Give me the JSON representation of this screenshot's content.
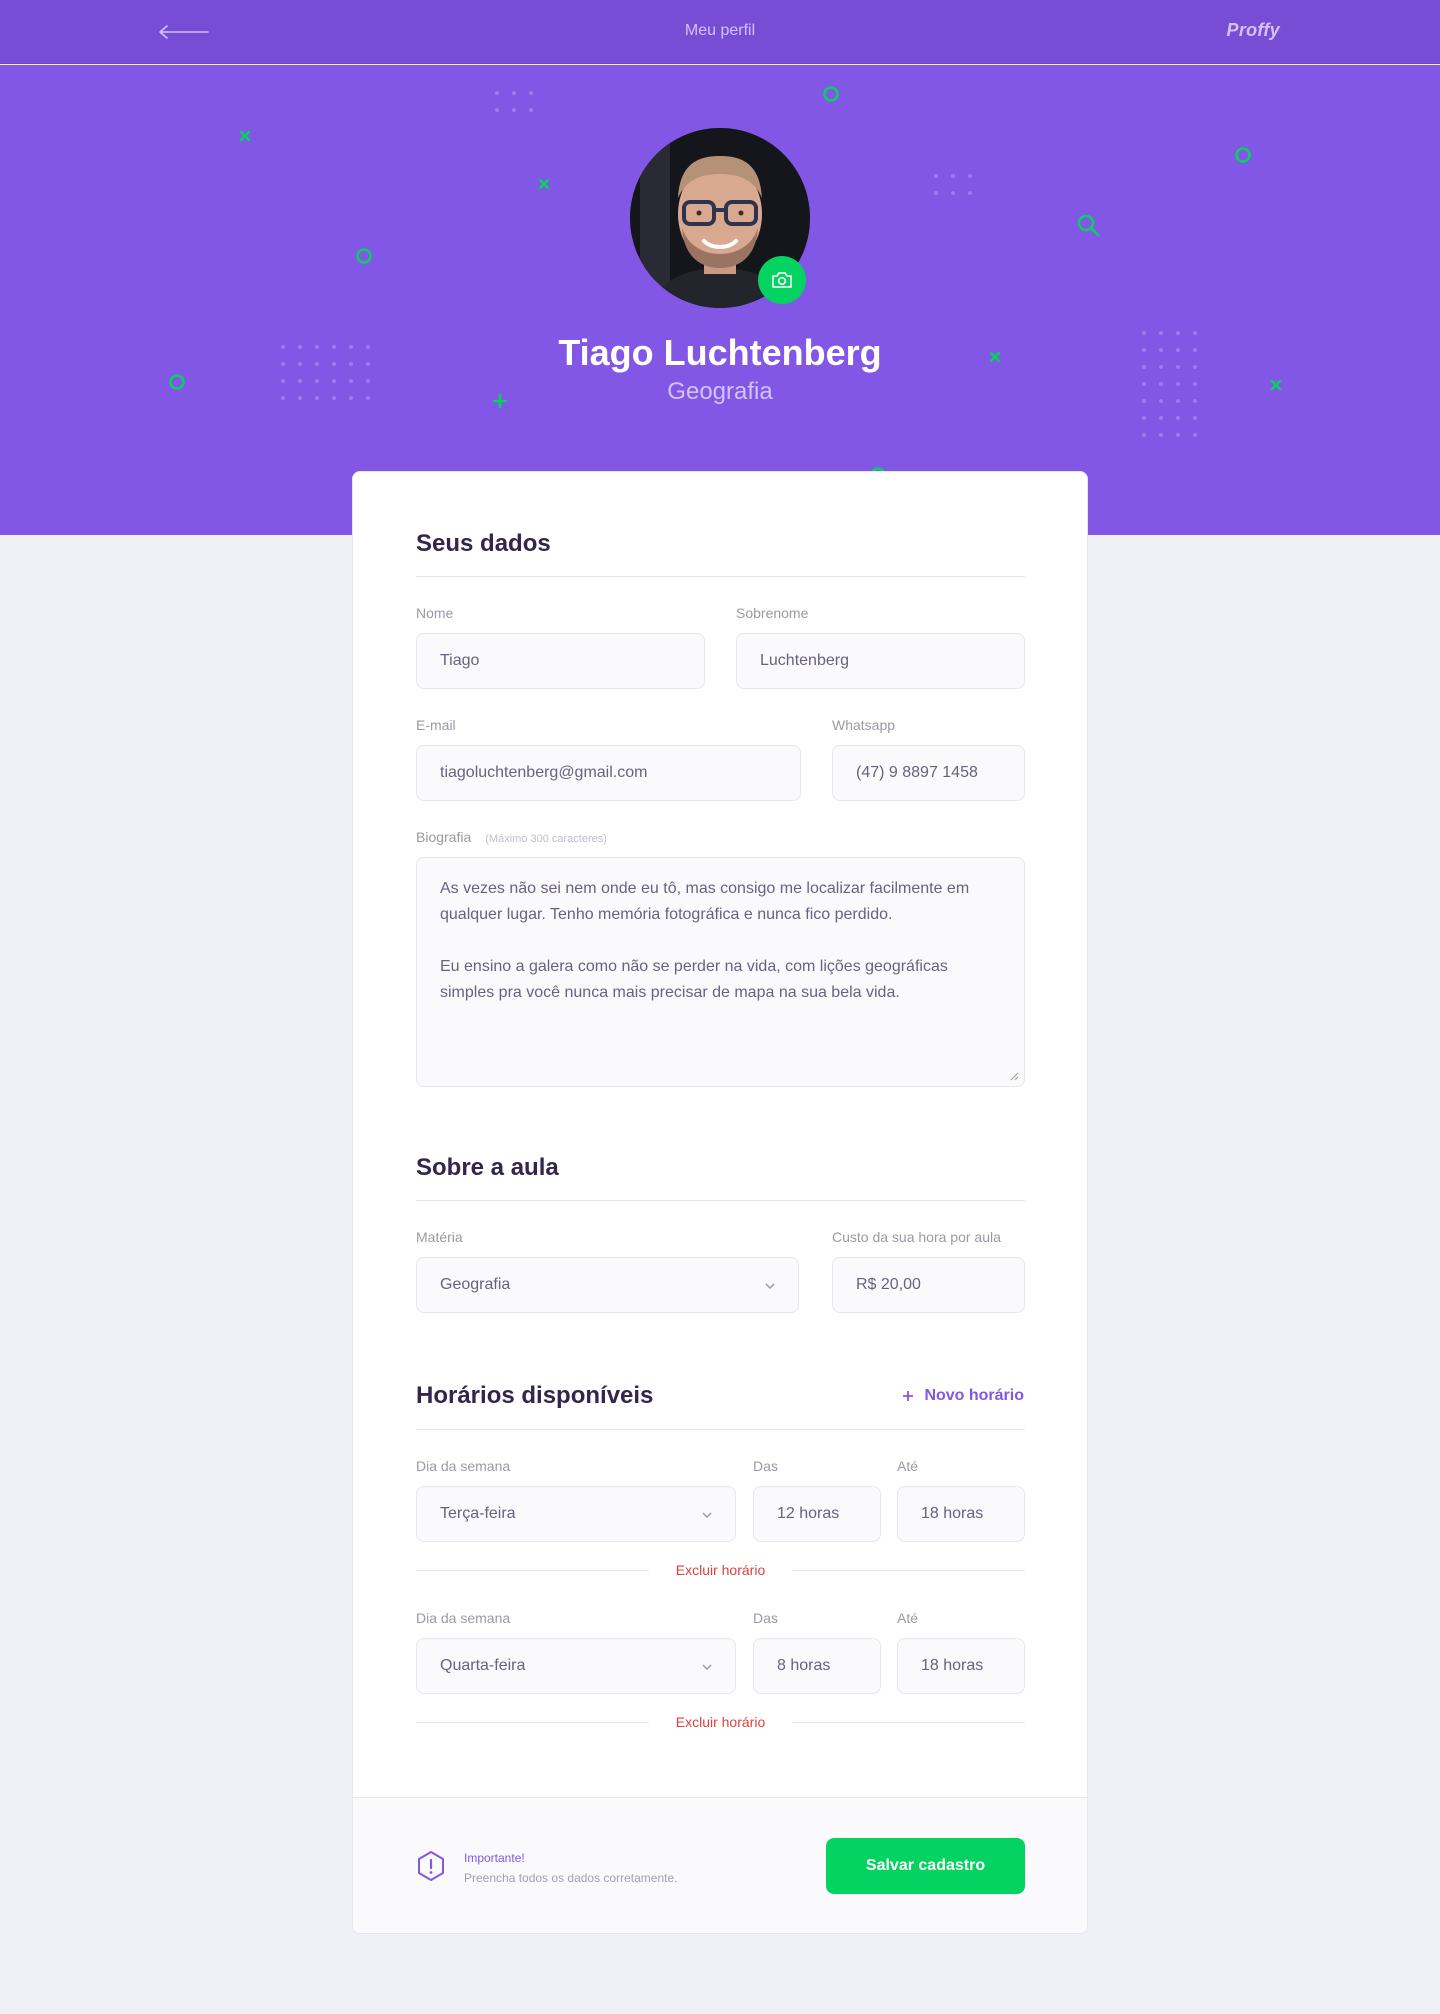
{
  "topbar": {
    "title": "Meu perfil",
    "brand": "Proffy"
  },
  "profile": {
    "name": "Tiago Luchtenberg",
    "subject": "Geografia"
  },
  "personal": {
    "section_title": "Seus dados",
    "first_name": {
      "label": "Nome",
      "value": "Tiago"
    },
    "last_name": {
      "label": "Sobrenome",
      "value": "Luchtenberg"
    },
    "email": {
      "label": "E-mail",
      "value": "tiagoluchtenberg@gmail.com"
    },
    "whatsapp": {
      "label": "Whatsapp",
      "value": "(47)  9 8897 1458"
    },
    "bio": {
      "label": "Biografia",
      "hint": "(Máximo 300 caracteres)",
      "paragraph1": "As vezes não sei nem onde eu tô, mas consigo me localizar facilmente em qualquer lugar. Tenho memória fotográfica e nunca fico perdido.",
      "paragraph2": "Eu ensino a galera como não se perder na vida, com lições geográficas simples pra você nunca mais precisar de mapa na sua bela vida."
    }
  },
  "class": {
    "section_title": "Sobre a aula",
    "subject": {
      "label": "Matéria",
      "value": "Geografia"
    },
    "cost": {
      "label": "Custo da sua hora por aula",
      "value": "R$ 20,00"
    }
  },
  "schedule": {
    "section_title": "Horários disponíveis",
    "new_label": "Novo horário",
    "items": [
      {
        "day_label": "Dia da semana",
        "day": "Terça-feira",
        "from_label": "Das",
        "from": "12 horas",
        "to_label": "Até",
        "to": "18 horas",
        "delete_label": "Excluir horário"
      },
      {
        "day_label": "Dia da semana",
        "day": "Quarta-feira",
        "from_label": "Das",
        "from": "8 horas",
        "to_label": "Até",
        "to": "18 horas",
        "delete_label": "Excluir horário"
      }
    ]
  },
  "footer": {
    "warning_title": "Importante!",
    "warning_text": "Preencha todos os dados corretamente.",
    "save_label": "Salvar cadastro"
  },
  "colors": {
    "primary": "#8257E5",
    "primary_dark": "#774DD6",
    "secondary": "#04D361",
    "danger": "#E33D3D",
    "background": "#F0F0F7"
  }
}
